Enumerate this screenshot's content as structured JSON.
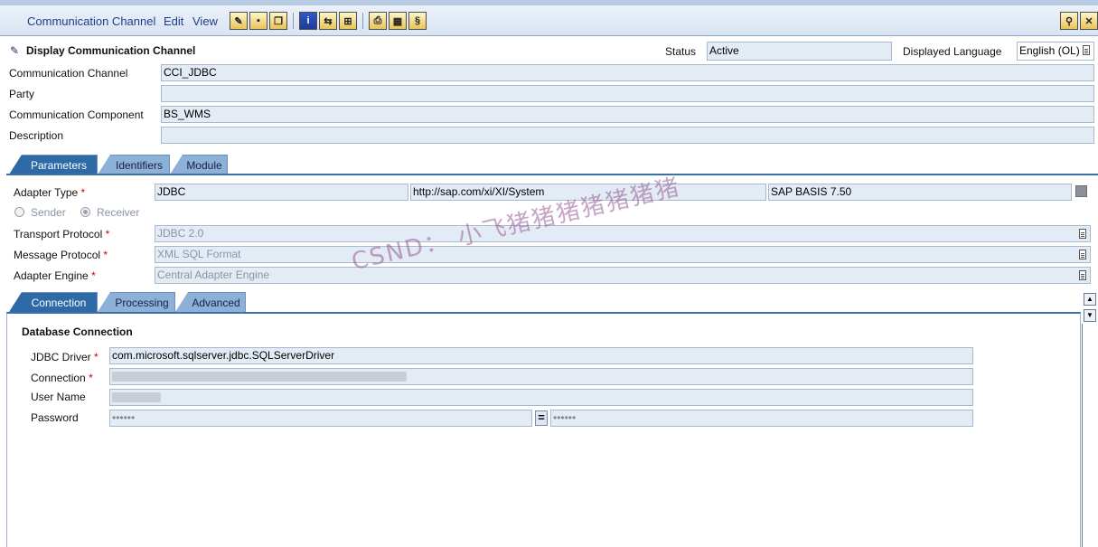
{
  "menu": {
    "communication_channel": "Communication Channel",
    "edit": "Edit",
    "view": "View"
  },
  "header": {
    "title": "Display Communication Channel",
    "status_label": "Status",
    "status_value": "Active",
    "language_label": "Displayed Language",
    "language_value": "English (OL)"
  },
  "object": {
    "channel_label": "Communication Channel",
    "channel_value": "CCI_JDBC",
    "party_label": "Party",
    "party_value": "",
    "component_label": "Communication Component",
    "component_value": "BS_WMS",
    "description_label": "Description",
    "description_value": ""
  },
  "main_tabs": [
    "Parameters",
    "Identifiers",
    "Module"
  ],
  "params": {
    "adapter_type_label": "Adapter Type",
    "adapter_type": "JDBC",
    "adapter_namespace": "http://sap.com/xi/XI/System",
    "adapter_swcv": "SAP BASIS 7.50",
    "sender_label": "Sender",
    "receiver_label": "Receiver",
    "transport_label": "Transport Protocol",
    "transport_value": "JDBC 2.0",
    "message_label": "Message Protocol",
    "message_value": "XML SQL Format",
    "engine_label": "Adapter Engine",
    "engine_value": "Central Adapter Engine",
    "required_mark": "*"
  },
  "sub_tabs": [
    "Connection",
    "Processing",
    "Advanced"
  ],
  "connection": {
    "section_title": "Database Connection",
    "driver_label": "JDBC Driver",
    "driver_value": "com.microsoft.sqlserver.jdbc.SQLServerDriver",
    "connection_label": "Connection",
    "connection_value": "",
    "user_label": "User Name",
    "user_value": "",
    "password_label": "Password",
    "password_value": "••••••",
    "password_confirm": "••••••",
    "equals": "="
  },
  "watermark": "CSND： 小飞猪猪猪猪猪猪猪"
}
